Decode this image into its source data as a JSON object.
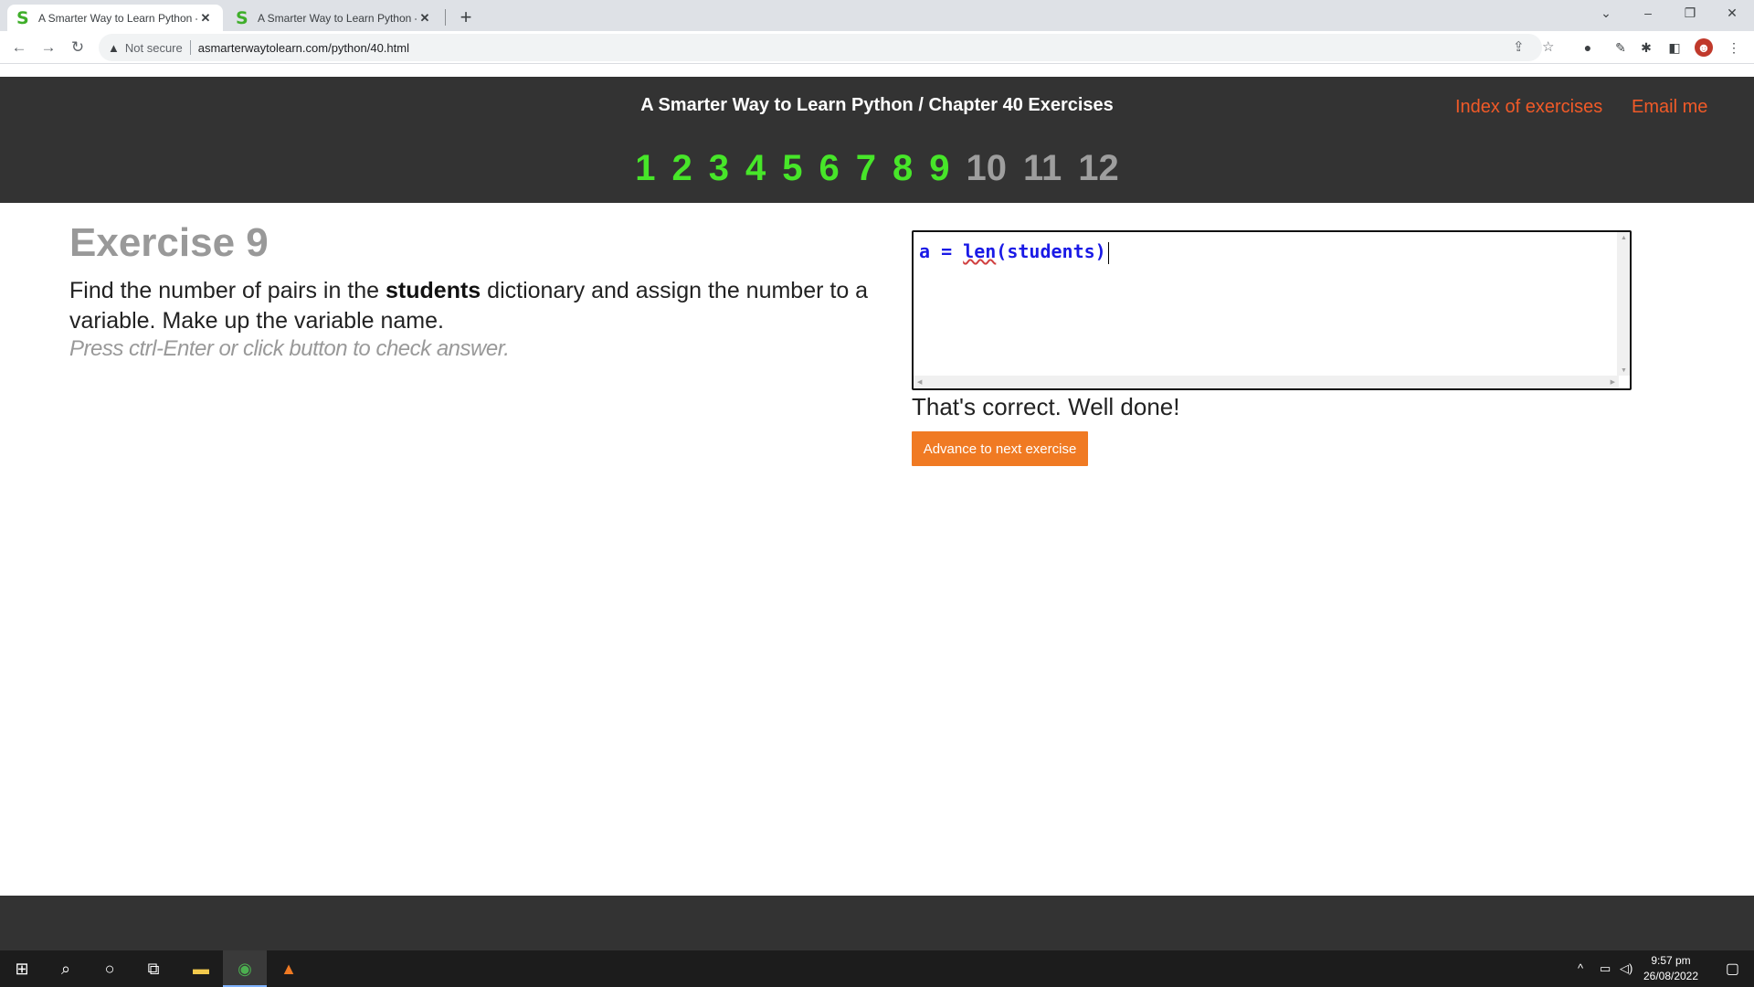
{
  "browser": {
    "tabs": [
      {
        "favicon": "S",
        "title": "A Smarter Way to Learn Python -",
        "close": "✕"
      },
      {
        "favicon": "S",
        "title": "A Smarter Way to Learn Python -",
        "close": "✕"
      }
    ],
    "new_tab": "+",
    "security_label": "Not secure",
    "url": "asmarterwaytolearn.com/python/40.html"
  },
  "header": {
    "title": "A Smarter Way to Learn Python / Chapter 40 Exercises",
    "links": {
      "index": "Index of exercises",
      "email": "Email me"
    },
    "exercise_numbers": [
      {
        "label": "1",
        "completed": true
      },
      {
        "label": "2",
        "completed": true
      },
      {
        "label": "3",
        "completed": true
      },
      {
        "label": "4",
        "completed": true
      },
      {
        "label": "5",
        "completed": true
      },
      {
        "label": "6",
        "completed": true
      },
      {
        "label": "7",
        "completed": true
      },
      {
        "label": "8",
        "completed": true
      },
      {
        "label": "9",
        "completed": true
      },
      {
        "label": "10",
        "completed": false
      },
      {
        "label": "11",
        "completed": false
      },
      {
        "label": "12",
        "completed": false
      }
    ]
  },
  "exercise": {
    "title": "Exercise 9",
    "text_before": "Find the number of pairs in the ",
    "text_bold": "students",
    "text_after": " dictionary and assign the number to a variable. Make up the variable name.",
    "hint": "Press ctrl-Enter or click button to check answer."
  },
  "editor": {
    "code_prefix": "a = ",
    "code_fn": "len",
    "code_suffix": "(students)"
  },
  "result": {
    "message": "That's correct. Well done!",
    "advance_label": "Advance to next exercise"
  },
  "taskbar": {
    "time": "9:57 pm",
    "date": "26/08/2022"
  },
  "colors": {
    "header_bg": "#333333",
    "completed_number": "#47e629",
    "pending_number": "#9e9e9e",
    "link": "#f05a28",
    "button": "#f07a23"
  }
}
